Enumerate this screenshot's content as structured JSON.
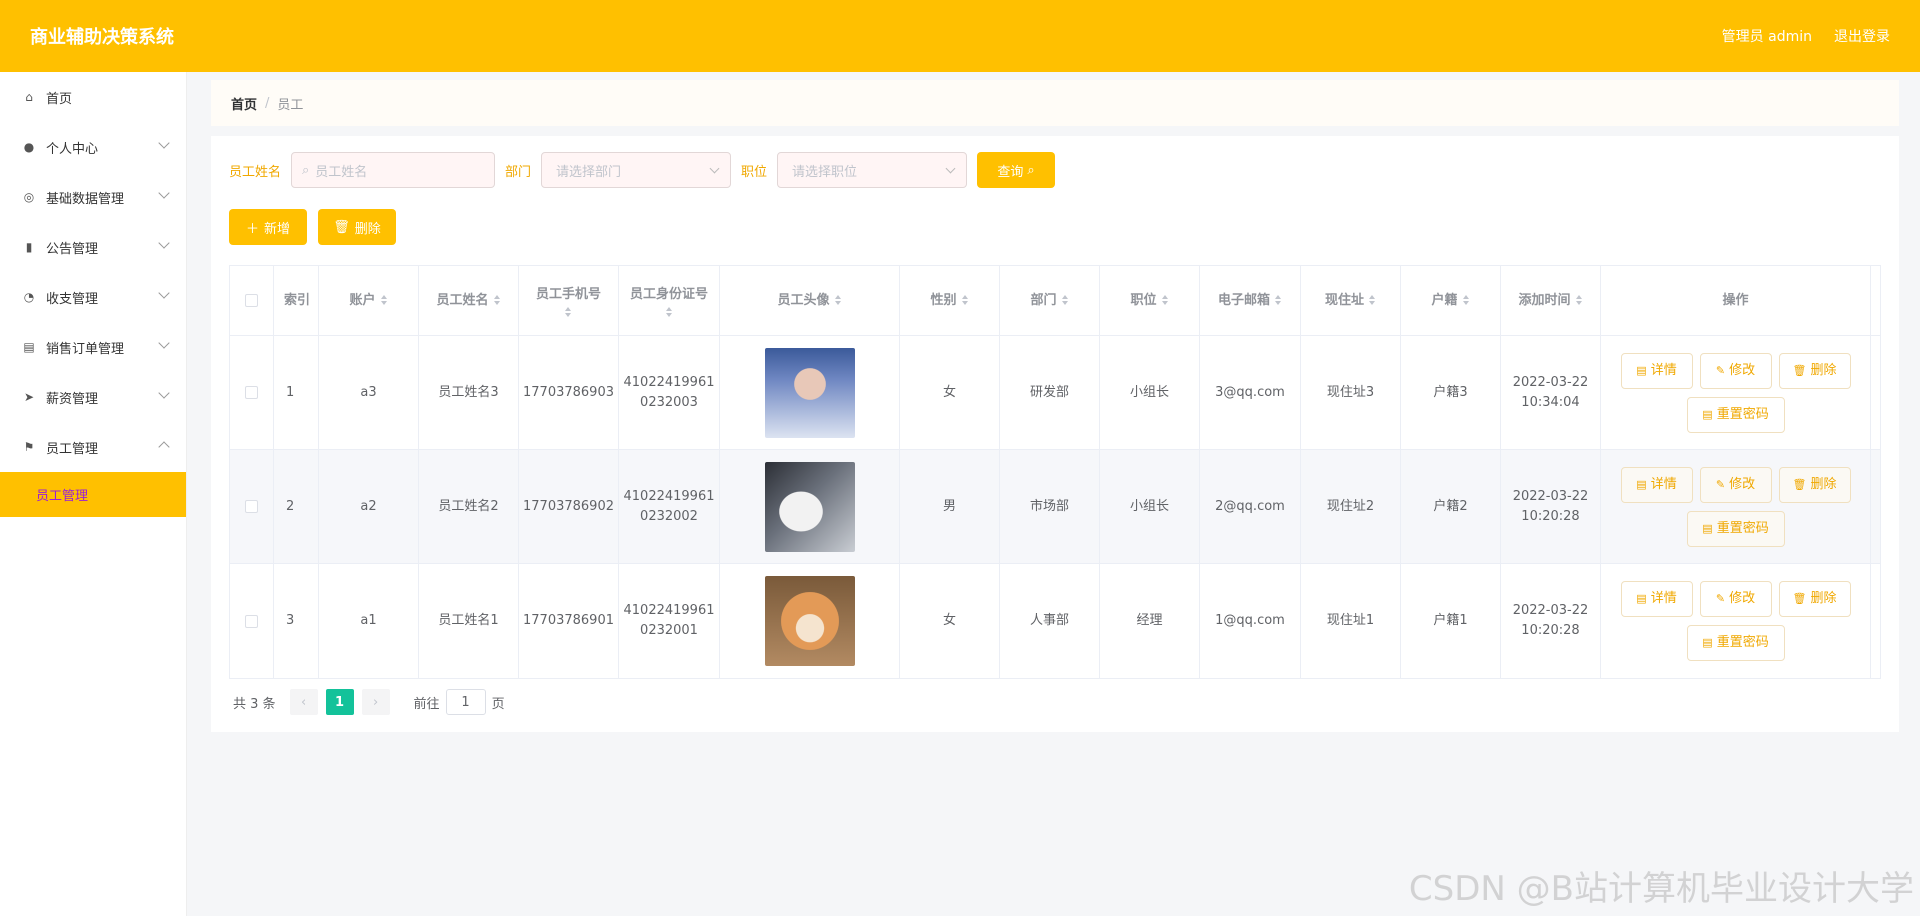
{
  "header": {
    "title": "商业辅助决策系统",
    "user": "管理员 admin",
    "logout": "退出登录"
  },
  "sidebar": {
    "items": [
      {
        "label": "首页",
        "icon": "home-icon",
        "glyph": "⌂"
      },
      {
        "label": "个人中心",
        "icon": "user-icon",
        "glyph": "●"
      },
      {
        "label": "基础数据管理",
        "icon": "database-icon",
        "glyph": "◎"
      },
      {
        "label": "公告管理",
        "icon": "bar-chart-icon",
        "glyph": "▮"
      },
      {
        "label": "收支管理",
        "icon": "gauge-icon",
        "glyph": "◔"
      },
      {
        "label": "销售订单管理",
        "icon": "clipboard-icon",
        "glyph": "▤"
      },
      {
        "label": "薪资管理",
        "icon": "send-icon",
        "glyph": "➤"
      },
      {
        "label": "员工管理",
        "icon": "flag-icon",
        "glyph": "⚑"
      }
    ],
    "active_sub": "员工管理"
  },
  "breadcrumb": {
    "home": "首页",
    "sep": "/",
    "current": "员工"
  },
  "search": {
    "name_label": "员工姓名",
    "name_placeholder": "员工姓名",
    "dept_label": "部门",
    "dept_placeholder": "请选择部门",
    "pos_label": "职位",
    "pos_placeholder": "请选择职位",
    "query_btn": "查询"
  },
  "actions": {
    "add": "新增",
    "delete": "删除"
  },
  "table": {
    "headers": [
      "索引",
      "账户",
      "员工姓名",
      "员工手机号",
      "员工身份证号",
      "员工头像",
      "性别",
      "部门",
      "职位",
      "电子邮箱",
      "现住址",
      "户籍",
      "添加时间",
      "操作"
    ],
    "rows": [
      {
        "index": "1",
        "account": "a3",
        "name": "员工姓名3",
        "phone": "17703786903",
        "id_line1": "41022419961",
        "id_line2": "0232003",
        "gender": "女",
        "dept": "研发部",
        "pos": "小组长",
        "email": "3@qq.com",
        "address": "现住址3",
        "huji": "户籍3",
        "date": "2022-03-22",
        "time": "10:34:04"
      },
      {
        "index": "2",
        "account": "a2",
        "name": "员工姓名2",
        "phone": "17703786902",
        "id_line1": "41022419961",
        "id_line2": "0232002",
        "gender": "男",
        "dept": "市场部",
        "pos": "小组长",
        "email": "2@qq.com",
        "address": "现住址2",
        "huji": "户籍2",
        "date": "2022-03-22",
        "time": "10:20:28"
      },
      {
        "index": "3",
        "account": "a1",
        "name": "员工姓名1",
        "phone": "17703786901",
        "id_line1": "41022419961",
        "id_line2": "0232001",
        "gender": "女",
        "dept": "人事部",
        "pos": "经理",
        "email": "1@qq.com",
        "address": "现住址1",
        "huji": "户籍1",
        "date": "2022-03-22",
        "time": "10:20:28"
      }
    ],
    "ops": {
      "detail": "详情",
      "edit": "修改",
      "delete": "删除",
      "reset": "重置密码"
    }
  },
  "pager": {
    "total": "共 3 条",
    "current": "1",
    "goto": "前往",
    "page_value": "1",
    "page_unit": "页"
  },
  "watermark": "CSDN @B站计算机毕业设计大学",
  "colors": {
    "accent": "#ffc000",
    "active_page": "#13c29a",
    "label": "#f0a800",
    "submenu_text": "#9c1fd6"
  }
}
